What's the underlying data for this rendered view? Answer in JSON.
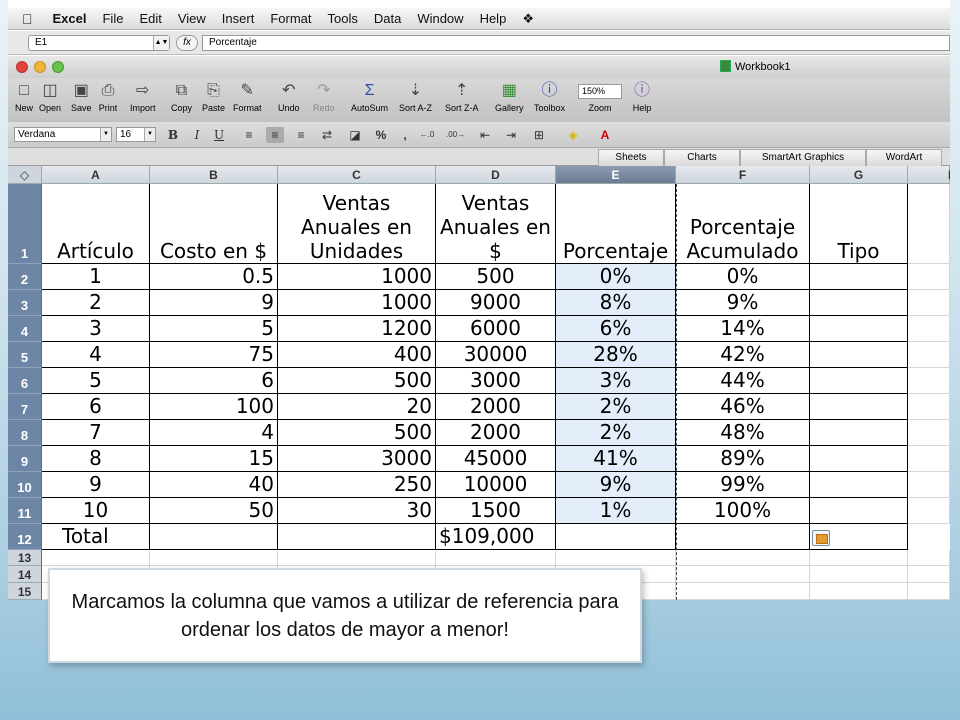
{
  "menubar": {
    "apple_icon": "apple-icon",
    "app_name": "Excel",
    "items": [
      "File",
      "Edit",
      "View",
      "Insert",
      "Format",
      "Tools",
      "Data",
      "Window",
      "Help"
    ],
    "script_icon": "script-icon"
  },
  "formula_bar": {
    "name_box": "E1",
    "fx_label": "fx",
    "formula": "Porcentaje"
  },
  "window": {
    "title": "Workbook1"
  },
  "toolbar": {
    "new": "New",
    "open": "Open",
    "save": "Save",
    "print": "Print",
    "import": "Import",
    "copy": "Copy",
    "paste": "Paste",
    "format": "Format",
    "undo": "Undo",
    "redo": "Redo",
    "autosum": "AutoSum",
    "sort_az": "Sort A-Z",
    "sort_za": "Sort Z-A",
    "gallery": "Gallery",
    "toolbox": "Toolbox",
    "zoom": "Zoom",
    "zoom_value": "150%",
    "help": "Help"
  },
  "format_bar": {
    "font": "Verdana",
    "size": "16",
    "bold": "B",
    "italic": "I",
    "underline": "U"
  },
  "ribbon": {
    "tabs": [
      "Sheets",
      "Charts",
      "SmartArt Graphics",
      "WordArt"
    ]
  },
  "sheet": {
    "corner": "◇",
    "columns": [
      "A",
      "B",
      "C",
      "D",
      "E",
      "F",
      "G",
      "H"
    ],
    "rows": [
      "1",
      "2",
      "3",
      "4",
      "5",
      "6",
      "7",
      "8",
      "9",
      "10",
      "11",
      "12",
      "13",
      "14",
      "15"
    ],
    "headers": {
      "a": "Artículo",
      "b": "Costo en $",
      "c": "Ventas Anuales en Unidades",
      "d": "Ventas Anuales en $",
      "e": "Porcentaje",
      "f": "Porcentaje Acumulado",
      "g": "Tipo"
    },
    "data": [
      {
        "a": "1",
        "b": "0.5",
        "c": "1000",
        "d": "500",
        "e": "0%",
        "f": "0%"
      },
      {
        "a": "2",
        "b": "9",
        "c": "1000",
        "d": "9000",
        "e": "8%",
        "f": "9%"
      },
      {
        "a": "3",
        "b": "5",
        "c": "1200",
        "d": "6000",
        "e": "6%",
        "f": "14%"
      },
      {
        "a": "4",
        "b": "75",
        "c": "400",
        "d": "30000",
        "e": "28%",
        "f": "42%"
      },
      {
        "a": "5",
        "b": "6",
        "c": "500",
        "d": "3000",
        "e": "3%",
        "f": "44%"
      },
      {
        "a": "6",
        "b": "100",
        "c": "20",
        "d": "2000",
        "e": "2%",
        "f": "46%"
      },
      {
        "a": "7",
        "b": "4",
        "c": "500",
        "d": "2000",
        "e": "2%",
        "f": "48%"
      },
      {
        "a": "8",
        "b": "15",
        "c": "3000",
        "d": "45000",
        "e": "41%",
        "f": "89%"
      },
      {
        "a": "9",
        "b": "40",
        "c": "250",
        "d": "10000",
        "e": "9%",
        "f": "99%"
      },
      {
        "a": "10",
        "b": "50",
        "c": "30",
        "d": "1500",
        "e": "1%",
        "f": "100%"
      }
    ],
    "total_label": "Total",
    "total_value": "$109,000"
  },
  "callout": {
    "text": "Marcamos la columna que vamos a utilizar de referencia para ordenar los datos de mayor a menor!"
  }
}
